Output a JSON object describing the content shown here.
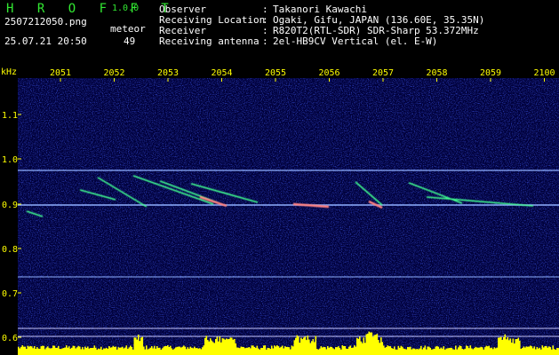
{
  "header": {
    "app_title": "H R O F F T",
    "version": "1.0.0",
    "filename": "2507212050.png",
    "event_type": "meteor",
    "timestamp": "25.07.21 20:50",
    "count": "49",
    "info": [
      {
        "label": "Observer",
        "value": "Takanori Kawachi"
      },
      {
        "label": "Receiving Location",
        "value": "Ogaki, Gifu, JAPAN (136.60E, 35.35N)"
      },
      {
        "label": "Receiver",
        "value": "R820T2(RTL-SDR) SDR-Sharp 53.372MHz"
      },
      {
        "label": "Receiving antenna",
        "value": "2el-HB9CV Vertical (el. E-W)"
      }
    ]
  },
  "spectrogram": {
    "y_unit": "kHz",
    "y_ticks": [
      "1.1",
      "1.0",
      "0.9",
      "0.8",
      "0.7",
      "0.6"
    ],
    "x_ticks": [
      "2051",
      "2052",
      "2053",
      "2054",
      "2055",
      "2056",
      "2057",
      "2058",
      "2059",
      "2100"
    ],
    "colors": {
      "background": "#00003a",
      "tick_label": "#ffff00",
      "carrier_line": "#8fb0ff",
      "meteor_trail": "#40ff90",
      "meteor_head": "#ff8080",
      "level_bar": "#ffff00"
    }
  }
}
